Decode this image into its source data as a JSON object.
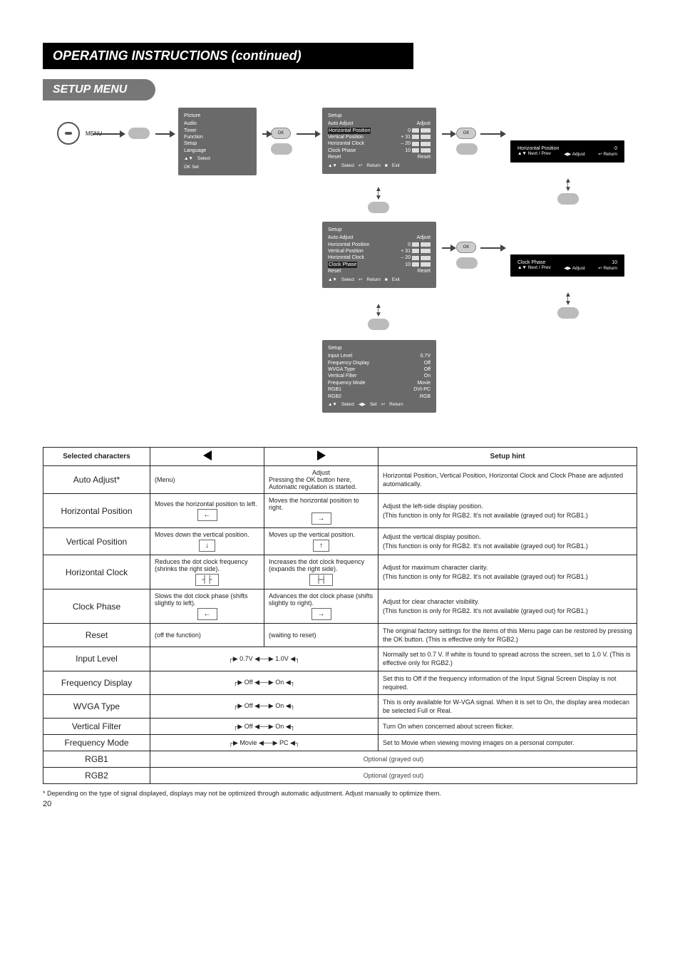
{
  "page": {
    "number": "20"
  },
  "titlebar": "OPERATING INSTRUCTIONS (continued)",
  "setup_band": "SETUP MENU",
  "menu_button_label": "MENU",
  "ok_labels": {
    "ok": "OK"
  },
  "osd_main": {
    "title": "Picture",
    "items": [
      "Audio",
      "Timer",
      "Function",
      "Setup",
      "Language"
    ],
    "footer_select": "Select",
    "footer_set": "OK Set"
  },
  "osd_setup_hp": {
    "title": "Setup",
    "rows": [
      {
        "l": "Auto Adjust",
        "r": "Adjust"
      },
      {
        "l": "Horizontal Position",
        "r": "0",
        "hl": true
      },
      {
        "l": "Vertical Position",
        "r": "+ 31"
      },
      {
        "l": "Horizontal Clock",
        "r": "– 20"
      },
      {
        "l": "Clock Phase",
        "r": "10"
      },
      {
        "l": "Reset",
        "r": "Reset"
      }
    ],
    "footer": [
      "Select",
      "Return",
      "Exit"
    ]
  },
  "osd_setup_cp": {
    "title": "Setup",
    "rows": [
      {
        "l": "Auto Adjust",
        "r": "Adjust"
      },
      {
        "l": "Horizontal Position",
        "r": "0"
      },
      {
        "l": "Vertical Position",
        "r": "+ 31"
      },
      {
        "l": "Horizontal Clock",
        "r": "– 20"
      },
      {
        "l": "Clock Phase",
        "r": "10",
        "hl": true
      },
      {
        "l": "Reset",
        "r": "Reset"
      }
    ],
    "footer": [
      "Select",
      "Return",
      "Exit"
    ]
  },
  "osd_setup_pg2": {
    "title": "Setup",
    "rows": [
      {
        "l": "Input Level",
        "r": "0.7V"
      },
      {
        "l": "Frequency Display",
        "r": "Off"
      },
      {
        "l": "WVGA Type",
        "r": "Off"
      },
      {
        "l": "Vertical Filter",
        "r": "On"
      },
      {
        "l": "Frequency Mode",
        "r": "Movie"
      },
      {
        "l": "RGB1",
        "r": "DVI-PC"
      },
      {
        "l": "RGB2",
        "r": "RGB"
      }
    ],
    "footer": [
      "Select",
      "Set",
      "Return"
    ]
  },
  "black_hp": {
    "title": "Horizontal Position",
    "val": "0",
    "footer": [
      "Next / Prev",
      "Adjust",
      "Return"
    ]
  },
  "black_cp": {
    "title": "Clock Phase",
    "val": "10",
    "footer": [
      "Next / Prev",
      "Adjust",
      "Return"
    ]
  },
  "table": {
    "head": {
      "sel": "Selected characters",
      "left": "",
      "right": "",
      "hint": "Setup hint"
    },
    "rows": [
      {
        "name": "Auto Adjust*",
        "left_label": "(Menu)",
        "left_desc": "",
        "right_label": "Adjust",
        "right_desc": "Pressing the OK button here, Automatic regulation is started.",
        "hint": "Horizontal Position, Vertical Position, Horizontal Clock and Clock Phase are adjusted automatically."
      },
      {
        "name": "Horizontal Position",
        "left_label": "Moves the horizontal position to left.",
        "left_glyph": "←",
        "right_label": "Moves the horizontal position to right.",
        "right_glyph": "→",
        "hint": "Adjust the left-side display position.\n(This function is only for RGB2. It's not available (grayed out) for RGB1.)"
      },
      {
        "name": "Vertical Position",
        "left_label": "Moves down the vertical position.",
        "left_glyph": "↓",
        "right_label": "Moves up the vertical position.",
        "right_glyph": "↑",
        "hint": "Adjust the vertical display position.\n(This function is only for RGB2. It's not available (grayed out) for RGB1.)"
      },
      {
        "name": "Horizontal Clock",
        "left_label": "Reduces the dot clock frequency (shrinks the right side).",
        "left_glyph": "┤├",
        "right_label": "Increases the dot clock frequency (expands the right side).",
        "right_glyph": "├┤",
        "hint": "Adjust for maximum character clarity.\n(This function is only for RGB2. It's not available (grayed out) for RGB1.)"
      },
      {
        "name": "Clock Phase",
        "left_label": "Slows the dot clock phase (shifts slightly to left).",
        "left_glyph": "←",
        "right_label": "Advances the dot clock phase (shifts slightly to right).",
        "right_glyph": "→",
        "hint": "Adjust for clear character visibility.\n(This function is only for RGB2. It's not available (grayed out) for RGB1.)"
      },
      {
        "name": "Reset",
        "left_label": "(off the function)",
        "right_label": "(waiting to reset)",
        "hint": "The original factory settings for the items of this Menu page can be restored by pressing the OK button. (This is effective only for RGB2.)"
      },
      {
        "name": "Input Level",
        "cycle": "0.7V ◀───────▶ 1.0V",
        "hint": "Normally set to 0.7 V. If white is found to spread across the screen, set to 1.0 V. (This is effective only for RGB2.)"
      },
      {
        "name": "Frequency Display",
        "cycle": "Off ◀─▶ On",
        "hint": "Set this to Off if the frequency information of the Input Signal Screen Display is not required."
      },
      {
        "name": "WVGA Type",
        "cycle": "Off ◀─▶ On",
        "hint": "This is only available for W-VGA signal.\nWhen it is set to On, the display area modecan be selected Full or Real."
      },
      {
        "name": "Vertical Filter",
        "cycle": "Off ◀─▶ On",
        "hint": "Turn On when concerned about screen flicker."
      },
      {
        "name": "Frequency Mode",
        "cycle": "Movie ◀─▶ PC",
        "hint": "Set to Movie when viewing moving images on a personal computer."
      },
      {
        "name": "RGB1",
        "gray": "Optional (grayed out)"
      },
      {
        "name": "RGB2",
        "gray": "Optional (grayed out)"
      }
    ]
  },
  "footnote": "* Depending on the type of signal displayed, displays may not be optimized through automatic adjustment. Adjust manually to optimize them."
}
